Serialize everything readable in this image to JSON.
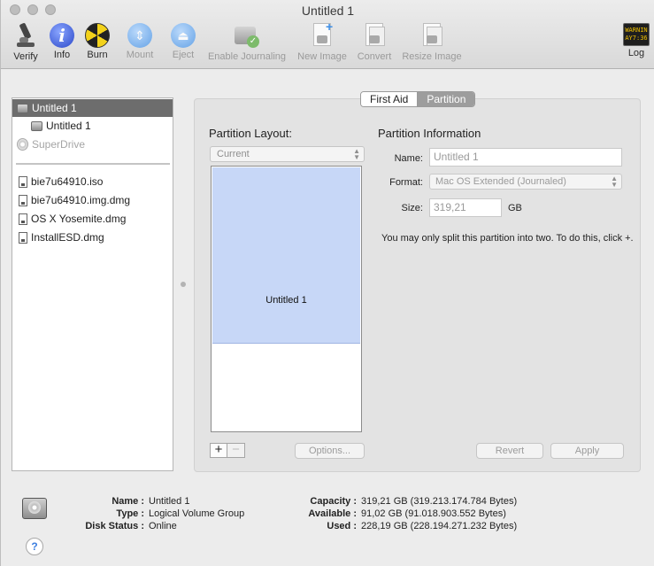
{
  "window": {
    "title": "Untitled 1"
  },
  "toolbar": {
    "verify": "Verify",
    "info": "Info",
    "burn": "Burn",
    "mount": "Mount",
    "eject": "Eject",
    "enable_journaling": "Enable Journaling",
    "new_image": "New Image",
    "convert": "Convert",
    "resize_image": "Resize Image",
    "log": "Log",
    "log_icon_text": "WARNIN\nAY7:36"
  },
  "sidebar": {
    "items": [
      {
        "label": "Untitled 1",
        "icon": "hard-disk-icon",
        "selected": true
      },
      {
        "label": "Untitled 1",
        "icon": "volume-icon"
      },
      {
        "label": "SuperDrive",
        "icon": "optical-disc-icon",
        "dim": true
      },
      {
        "label": "bie7u64910.iso",
        "icon": "disk-image-icon"
      },
      {
        "label": "bie7u64910.img.dmg",
        "icon": "disk-image-icon"
      },
      {
        "label": "OS X Yosemite.dmg",
        "icon": "disk-image-icon"
      },
      {
        "label": "InstallESD.dmg",
        "icon": "disk-image-icon"
      }
    ]
  },
  "tabs": {
    "first_aid": "First Aid",
    "partition": "Partition",
    "active": "Partition"
  },
  "partition": {
    "layout_title": "Partition Layout:",
    "layout_value": "Current",
    "volume_name": "Untitled 1",
    "volume_fraction": 0.67,
    "info_title": "Partition Information",
    "name_label": "Name:",
    "name_value": "Untitled 1",
    "format_label": "Format:",
    "format_value": "Mac OS Extended (Journaled)",
    "size_label": "Size:",
    "size_value": "319,21",
    "size_unit": "GB",
    "help_text": "You may only split this partition into two. To do this, click +.",
    "add": "+",
    "remove": "−",
    "options": "Options...",
    "revert": "Revert",
    "apply": "Apply"
  },
  "disk_info": {
    "name_key": "Name :",
    "name_value": "Untitled 1",
    "type_key": "Type :",
    "type_value": "Logical Volume Group",
    "status_key": "Disk Status :",
    "status_value": "Online",
    "capacity_key": "Capacity :",
    "capacity_value": "319,21 GB (319.213.174.784 Bytes)",
    "available_key": "Available :",
    "available_value": "91,02 GB (91.018.903.552 Bytes)",
    "used_key": "Used :",
    "used_value": "228,19 GB (228.194.271.232 Bytes)"
  },
  "help": "?"
}
